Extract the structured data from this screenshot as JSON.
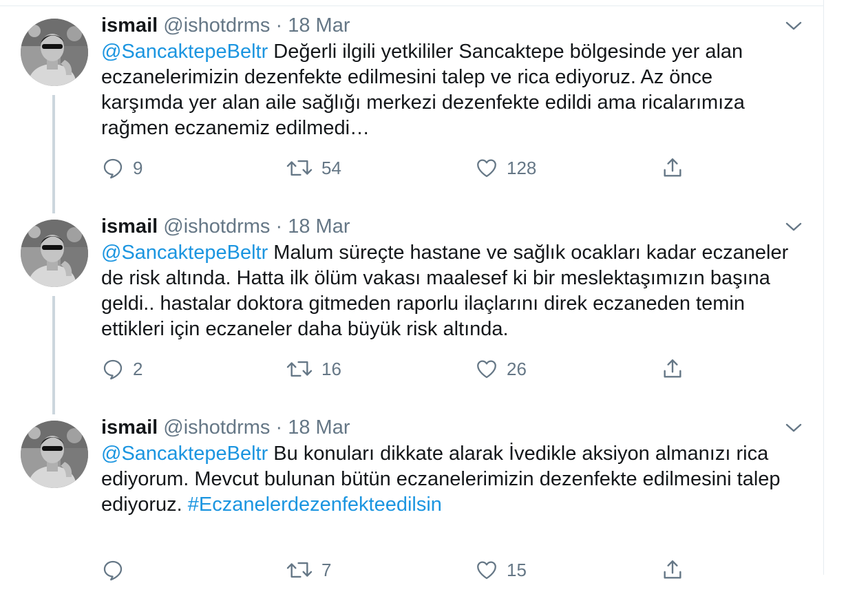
{
  "tweets": [
    {
      "name": "ismail",
      "handle": "@ishotdrms",
      "separator": "·",
      "date": "18 Mar",
      "mention": "@SancaktepeBeltr",
      "text": " Değerli ilgili yetkililer Sancaktepe bölgesinde yer alan eczanelerimizin dezenfekte edilmesini talep ve rica ediyoruz. Az önce karşımda yer alan aile sağlığı merkezi dezenfekte edildi ama ricalarımıza rağmen eczanemiz edilmedi…",
      "hashtag": "",
      "replies": "9",
      "retweets": "54",
      "likes": "128"
    },
    {
      "name": "ismail",
      "handle": "@ishotdrms",
      "separator": "·",
      "date": "18 Mar",
      "mention": "@SancaktepeBeltr",
      "text": " Malum süreçte hastane ve sağlık ocakları kadar eczaneler de risk altında. Hatta ilk ölüm vakası maalesef ki bir meslektaşımızın başına geldi.. hastalar doktora gitmeden raporlu ilaçlarını direk eczaneden temin ettikleri için eczaneler daha büyük risk altında.",
      "hashtag": "",
      "replies": "2",
      "retweets": "16",
      "likes": "26"
    },
    {
      "name": "ismail",
      "handle": "@ishotdrms",
      "separator": "·",
      "date": "18 Mar",
      "mention": "@SancaktepeBeltr",
      "text": " Bu konuları dikkate alarak İvedikle aksiyon almanızı rica ediyorum. Mevcut bulunan bütün eczanelerimizin dezenfekte edilmesini talep ediyoruz. ",
      "hashtag": "#Eczanelerdezenfekteedilsin",
      "replies": "",
      "retweets": "7",
      "likes": "15"
    }
  ],
  "icons": {
    "reply": "reply-icon",
    "retweet": "retweet-icon",
    "like": "like-icon",
    "share": "share-icon",
    "caret": "chevron-down-icon"
  },
  "colors": {
    "link": "#1b95e0",
    "secondary_text": "#657786",
    "thread_line": "#ccd6dd"
  }
}
